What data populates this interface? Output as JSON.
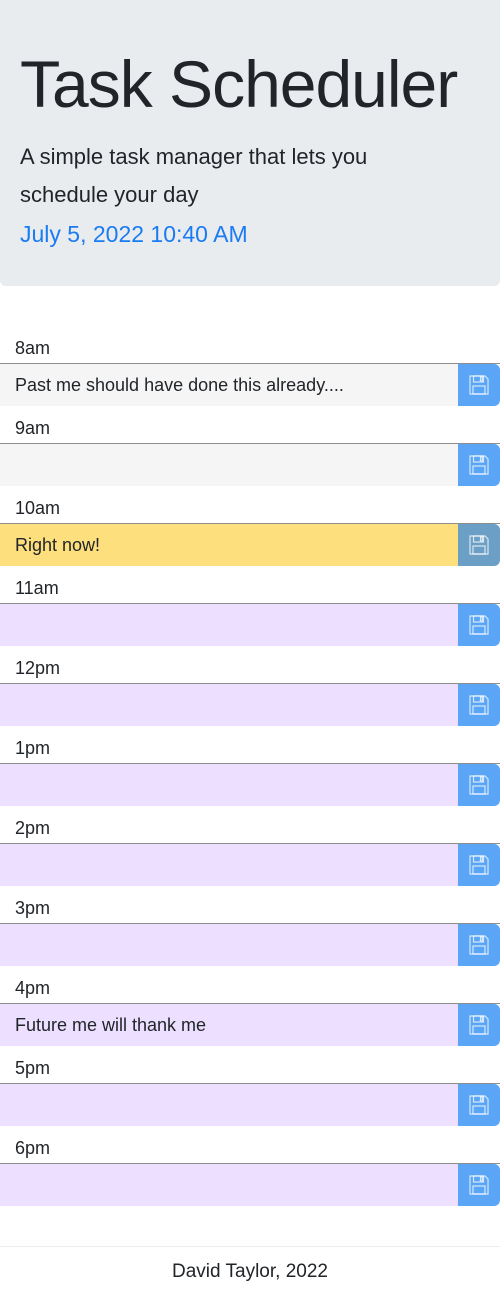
{
  "header": {
    "title": "Task Scheduler",
    "lead": "A simple task manager that lets you schedule your day",
    "datetime": "July 5, 2022 10:40 AM"
  },
  "colors": {
    "past": "#f5f5f5",
    "present": "#fedf7d",
    "future": "#ecdfff",
    "save": "#5aa5f6",
    "date": "#1a7bf2"
  },
  "schedule": [
    {
      "hour": "8am",
      "task": "Past me should have done this already....",
      "state": "past"
    },
    {
      "hour": "9am",
      "task": "",
      "state": "past"
    },
    {
      "hour": "10am",
      "task": "Right now!",
      "state": "present"
    },
    {
      "hour": "11am",
      "task": "",
      "state": "future"
    },
    {
      "hour": "12pm",
      "task": "",
      "state": "future"
    },
    {
      "hour": "1pm",
      "task": "",
      "state": "future"
    },
    {
      "hour": "2pm",
      "task": "",
      "state": "future"
    },
    {
      "hour": "3pm",
      "task": "",
      "state": "future"
    },
    {
      "hour": "4pm",
      "task": "Future me will thank me",
      "state": "future"
    },
    {
      "hour": "5pm",
      "task": "",
      "state": "future"
    },
    {
      "hour": "6pm",
      "task": "",
      "state": "future"
    }
  ],
  "save_icon": "floppy-disk-icon",
  "footer": {
    "text": "David Taylor, 2022"
  }
}
